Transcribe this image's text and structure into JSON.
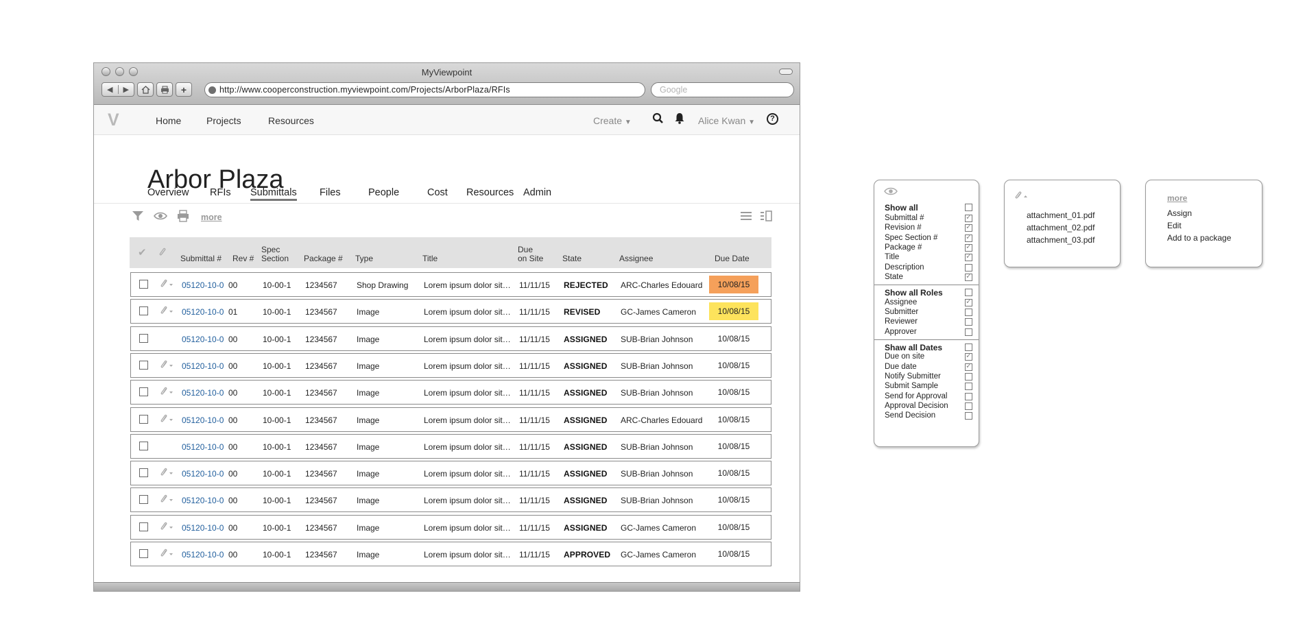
{
  "browser": {
    "window_title": "MyViewpoint",
    "url": "http://www.cooperconstruction.myviewpoint.com/Projects/ArborPlaza/RFIs",
    "search_placeholder": "Google"
  },
  "appnav": {
    "logo": "V",
    "links": [
      "Home",
      "Projects",
      "Resources"
    ],
    "create": "Create",
    "user": "Alice Kwan",
    "help": "?"
  },
  "page": {
    "title": "Arbor Plaza",
    "tabs": [
      "Overview",
      "RFIs",
      "Submittals",
      "Files",
      "People",
      "Cost",
      "Resources",
      "Admin"
    ],
    "active_tab": "Submittals",
    "more": "more"
  },
  "table": {
    "headers": {
      "submittal": "Submittal #",
      "rev": "Rev #",
      "spec1": "Spec",
      "spec2": "Section",
      "package": "Package #",
      "type": "Type",
      "title": "Title",
      "due1": "Due",
      "due2": "on Site",
      "state": "State",
      "assignee": "Assignee",
      "due_date": "Due Date"
    },
    "rows": [
      {
        "submittal": "05120-10-0",
        "rev": "00",
        "spec": "10-00-1",
        "package": "1234567",
        "type": "Shop Drawing",
        "title": "Lorem ipsum dolor sit…",
        "due_site": "11/11/15",
        "state": "REJECTED",
        "assignee": "ARC-Charles Edouard",
        "due_date": "10/08/15",
        "highlight": "#f5a05a",
        "attachment": true
      },
      {
        "submittal": "05120-10-0",
        "rev": "01",
        "spec": "10-00-1",
        "package": "1234567",
        "type": "Image",
        "title": "Lorem ipsum dolor sit…",
        "due_site": "11/11/15",
        "state": "REVISED",
        "assignee": "GC-James Cameron",
        "due_date": "10/08/15",
        "highlight": "#fde35c",
        "attachment": true
      },
      {
        "submittal": "05120-10-0",
        "rev": "00",
        "spec": "10-00-1",
        "package": "1234567",
        "type": "Image",
        "title": "Lorem ipsum dolor sit…",
        "due_site": "11/11/15",
        "state": "ASSIGNED",
        "assignee": "SUB-Brian Johnson",
        "due_date": "10/08/15",
        "highlight": "",
        "attachment": false
      },
      {
        "submittal": "05120-10-0",
        "rev": "00",
        "spec": "10-00-1",
        "package": "1234567",
        "type": "Image",
        "title": "Lorem ipsum dolor sit…",
        "due_site": "11/11/15",
        "state": "ASSIGNED",
        "assignee": "SUB-Brian Johnson",
        "due_date": "10/08/15",
        "highlight": "",
        "attachment": true
      },
      {
        "submittal": "05120-10-0",
        "rev": "00",
        "spec": "10-00-1",
        "package": "1234567",
        "type": "Image",
        "title": "Lorem ipsum dolor sit…",
        "due_site": "11/11/15",
        "state": "ASSIGNED",
        "assignee": "SUB-Brian Johnson",
        "due_date": "10/08/15",
        "highlight": "",
        "attachment": true
      },
      {
        "submittal": "05120-10-0",
        "rev": "00",
        "spec": "10-00-1",
        "package": "1234567",
        "type": "Image",
        "title": "Lorem ipsum dolor sit…",
        "due_site": "11/11/15",
        "state": "ASSIGNED",
        "assignee": "ARC-Charles Edouard",
        "due_date": "10/08/15",
        "highlight": "",
        "attachment": true
      },
      {
        "submittal": "05120-10-0",
        "rev": "00",
        "spec": "10-00-1",
        "package": "1234567",
        "type": "Image",
        "title": "Lorem ipsum dolor sit…",
        "due_site": "11/11/15",
        "state": "ASSIGNED",
        "assignee": "SUB-Brian Johnson",
        "due_date": "10/08/15",
        "highlight": "",
        "attachment": false
      },
      {
        "submittal": "05120-10-0",
        "rev": "00",
        "spec": "10-00-1",
        "package": "1234567",
        "type": "Image",
        "title": "Lorem ipsum dolor sit…",
        "due_site": "11/11/15",
        "state": "ASSIGNED",
        "assignee": "SUB-Brian Johnson",
        "due_date": "10/08/15",
        "highlight": "",
        "attachment": true
      },
      {
        "submittal": "05120-10-0",
        "rev": "00",
        "spec": "10-00-1",
        "package": "1234567",
        "type": "Image",
        "title": "Lorem ipsum dolor sit…",
        "due_site": "11/11/15",
        "state": "ASSIGNED",
        "assignee": "SUB-Brian Johnson",
        "due_date": "10/08/15",
        "highlight": "",
        "attachment": true
      },
      {
        "submittal": "05120-10-0",
        "rev": "00",
        "spec": "10-00-1",
        "package": "1234567",
        "type": "Image",
        "title": "Lorem ipsum dolor sit…",
        "due_site": "11/11/15",
        "state": "ASSIGNED",
        "assignee": "GC-James Cameron",
        "due_date": "10/08/15",
        "highlight": "",
        "attachment": true
      },
      {
        "submittal": "05120-10-0",
        "rev": "00",
        "spec": "10-00-1",
        "package": "1234567",
        "type": "Image",
        "title": "Lorem ipsum dolor sit…",
        "due_site": "11/11/15",
        "state": "APPROVED",
        "assignee": "GC-James Cameron",
        "due_date": "10/08/15",
        "highlight": "",
        "attachment": true
      }
    ]
  },
  "columns_panel": {
    "items": [
      {
        "label": "Show all",
        "header": true,
        "checked": false
      },
      {
        "label": "Submittal #",
        "header": false,
        "checked": true
      },
      {
        "label": "Revision #",
        "header": false,
        "checked": true
      },
      {
        "label": "Spec Section #",
        "header": false,
        "checked": true
      },
      {
        "label": "Package #",
        "header": false,
        "checked": true
      },
      {
        "label": "Title",
        "header": false,
        "checked": true
      },
      {
        "label": "Description",
        "header": false,
        "checked": false
      },
      {
        "label": "State",
        "header": false,
        "checked": true
      },
      {
        "label": "Show all Roles",
        "header": true,
        "checked": false
      },
      {
        "label": "Assignee",
        "header": false,
        "checked": true
      },
      {
        "label": "Submitter",
        "header": false,
        "checked": false
      },
      {
        "label": "Reviewer",
        "header": false,
        "checked": false
      },
      {
        "label": "Approver",
        "header": false,
        "checked": false
      },
      {
        "label": "Shaw all Dates",
        "header": true,
        "checked": false
      },
      {
        "label": "Due on site",
        "header": false,
        "checked": true
      },
      {
        "label": "Due date",
        "header": false,
        "checked": true
      },
      {
        "label": "Notify Submitter",
        "header": false,
        "checked": false
      },
      {
        "label": "Submit Sample",
        "header": false,
        "checked": false
      },
      {
        "label": "Send for Approval",
        "header": false,
        "checked": false
      },
      {
        "label": "Approval Decision",
        "header": false,
        "checked": false
      },
      {
        "label": "Send Decision",
        "header": false,
        "checked": false
      }
    ]
  },
  "attachments_panel": {
    "files": [
      "attachment_01.pdf",
      "attachment_02.pdf",
      "attachment_03.pdf"
    ]
  },
  "more_panel": {
    "title": "more",
    "items": [
      "Assign",
      "Edit",
      "Add to a package"
    ]
  }
}
